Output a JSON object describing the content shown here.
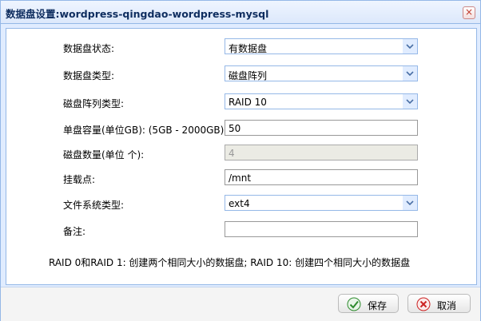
{
  "window": {
    "title": "数据盘设置:wordpress-qingdao-wordpress-mysql"
  },
  "form": {
    "fields": [
      {
        "label": "数据盘状态:",
        "value": "有数据盘",
        "type": "select"
      },
      {
        "label": "数据盘类型:",
        "value": "磁盘阵列",
        "type": "select"
      },
      {
        "label": "磁盘阵列类型:",
        "value": "RAID 10",
        "type": "select"
      },
      {
        "label": "单盘容量(单位GB): (5GB - 2000GB)",
        "value": "50",
        "type": "text"
      },
      {
        "label": "磁盘数量(单位 个):",
        "value": "4",
        "type": "text-disabled"
      },
      {
        "label": "挂载点:",
        "value": "/mnt",
        "type": "text"
      },
      {
        "label": "文件系统类型:",
        "value": "ext4",
        "type": "select"
      },
      {
        "label": "备注:",
        "value": "",
        "type": "text"
      }
    ],
    "note": "RAID 0和RAID 1: 创建两个相同大小的数据盘; RAID 10: 创建四个相同大小的数据盘"
  },
  "footer": {
    "save_label": "保存",
    "cancel_label": "取消"
  },
  "icons": {
    "close": "close-icon",
    "save": "check-icon",
    "cancel": "cancel-icon",
    "dropdown": "chevron-down-icon"
  },
  "colors": {
    "border": "#95b8e7",
    "titlebar": "#dce8fb",
    "save_icon": "#2e8b2e",
    "cancel_icon": "#cc2222"
  }
}
